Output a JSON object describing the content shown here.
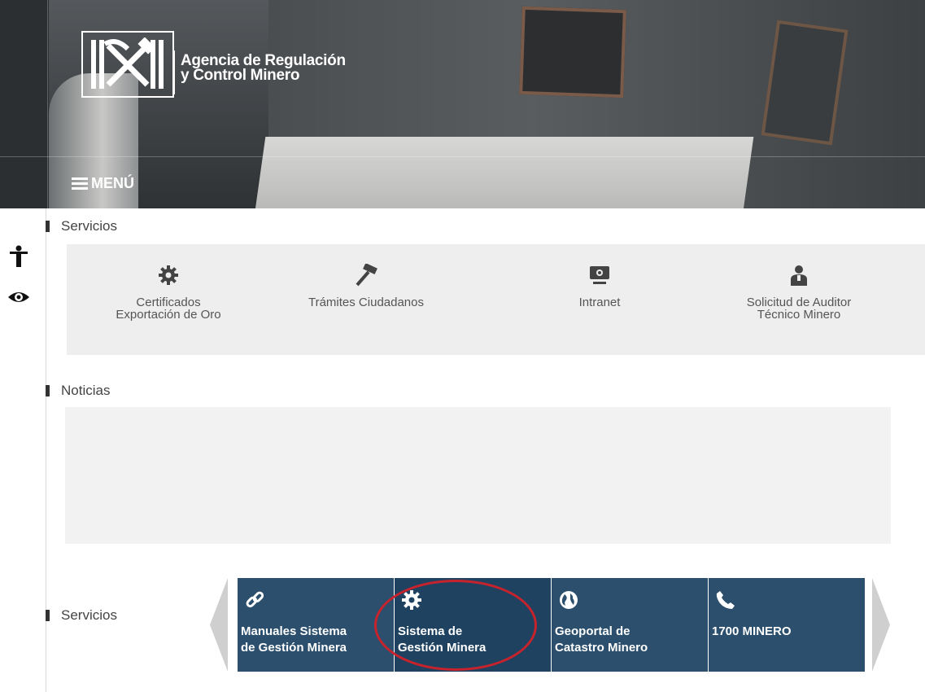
{
  "header": {
    "org_line1": "Agencia de Regulación",
    "org_line2": "y Control Minero",
    "menu_label": "MENÚ"
  },
  "accessibility": {
    "icons": [
      "accessibility-person-icon",
      "eye-icon"
    ]
  },
  "servicios_top": {
    "title": "Servicios",
    "items": [
      {
        "line1": "Certificados",
        "line2": "Exportación de Oro",
        "icon": "gear-icon"
      },
      {
        "line1": "Trámites Ciudadanos",
        "line2": "",
        "icon": "hammer-icon"
      },
      {
        "line1": "Intranet",
        "line2": "",
        "icon": "monitor-icon"
      },
      {
        "line1": "Solicitud de Auditor",
        "line2": "Técnico Minero",
        "icon": "user-icon"
      }
    ]
  },
  "noticias": {
    "title": "Noticias"
  },
  "servicios_bottom": {
    "title": "Servicios",
    "tiles": [
      {
        "line1": "Manuales Sistema",
        "line2": "de Gestión Minera",
        "icon": "link-icon"
      },
      {
        "line1": "Sistema de",
        "line2": "Gestión Minera",
        "icon": "gear-icon"
      },
      {
        "line1": "Geoportal de",
        "line2": "Catastro Minero",
        "icon": "globe-icon"
      },
      {
        "line1": "1700 MINERO",
        "line2": "",
        "icon": "phone-icon"
      }
    ]
  },
  "colors": {
    "tile": "#2b4f6c",
    "tile_active": "#1f4261",
    "highlight_circle": "#c8232c"
  }
}
